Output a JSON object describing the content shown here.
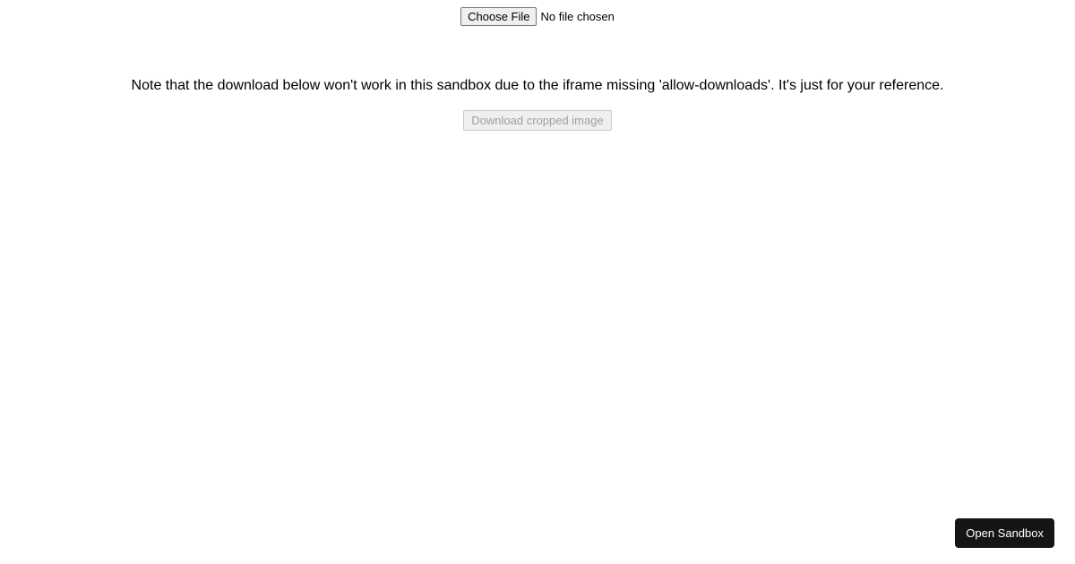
{
  "fileInput": {
    "buttonLabel": "Choose File",
    "statusText": "No file chosen"
  },
  "note": "Note that the download below won't work in this sandbox due to the iframe missing 'allow-downloads'. It's just for your reference.",
  "downloadButton": {
    "label": "Download cropped image"
  },
  "sandboxButton": {
    "label": "Open Sandbox"
  }
}
